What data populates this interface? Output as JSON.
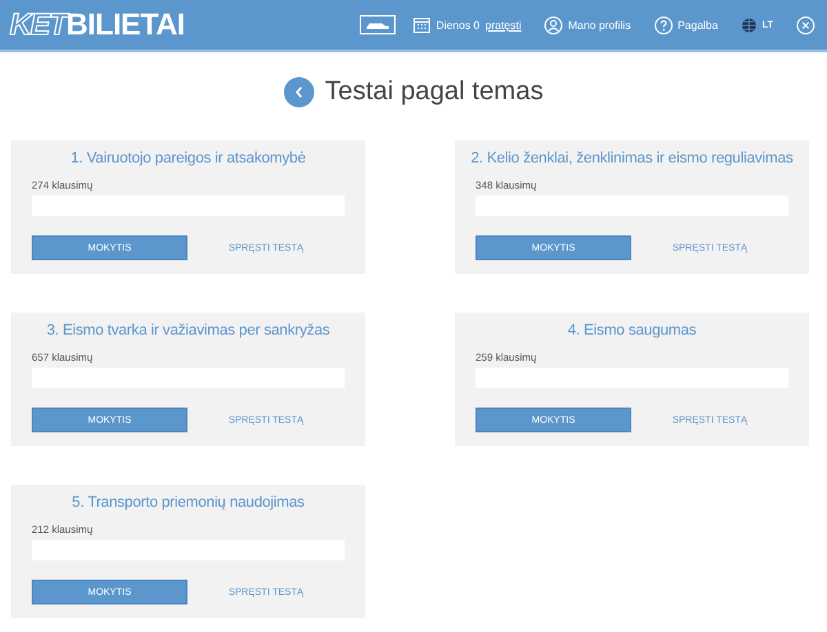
{
  "header": {
    "logo_outline": "KET",
    "logo_bold": "BILIETAI",
    "days_label": "Dienos 0",
    "days_link": "pratęsti",
    "profile": "Mano profilis",
    "help": "Pagalba",
    "language": "LT"
  },
  "page_title": "Testai pagal temas",
  "topics": [
    {
      "title": "1. Vairuotojo pareigos ir atsakomybė",
      "count": "274 klausimų",
      "level": 0,
      "learn": "MOKYTIS",
      "test": "SPRĘSTI TESTĄ"
    },
    {
      "title": "2. Kelio ženklai, ženklinimas ir eismo reguliavimas",
      "count": "348 klausimų",
      "level": 0,
      "learn": "MOKYTIS",
      "test": "SPRĘSTI TESTĄ"
    },
    {
      "title": "3. Eismo tvarka ir važiavimas per sankryžas",
      "count": "657 klausimų",
      "level": 0,
      "learn": "MOKYTIS",
      "test": "SPRĘSTI TESTĄ"
    },
    {
      "title": "4. Eismo saugumas",
      "count": "259 klausimų",
      "level": 0,
      "learn": "MOKYTIS",
      "test": "SPRĘSTI TESTĄ"
    },
    {
      "title": "5. Transporto priemonių naudojimas",
      "count": "212 klausimų",
      "level": 0,
      "learn": "MOKYTIS",
      "test": "SPRĘSTI TESTĄ"
    }
  ]
}
